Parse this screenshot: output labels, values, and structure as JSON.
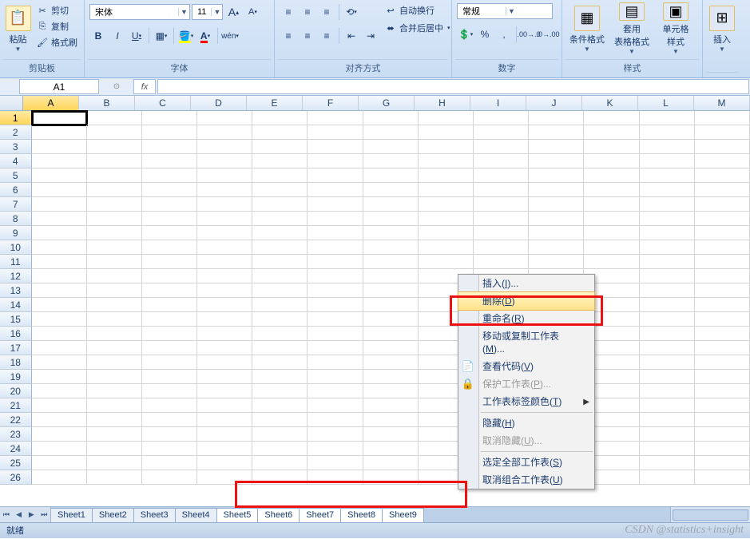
{
  "ribbon": {
    "clipboard": {
      "paste": "粘贴",
      "cut": "剪切",
      "copy": "复制",
      "format_painter": "格式刷",
      "group_label": "剪贴板"
    },
    "font": {
      "font_name": "宋体",
      "font_size": "11",
      "group_label": "字体"
    },
    "alignment": {
      "wrap_text": "自动换行",
      "merge_center": "合并后居中",
      "group_label": "对齐方式"
    },
    "number": {
      "format": "常规",
      "group_label": "数字"
    },
    "styles": {
      "conditional": "条件格式",
      "format_table": "套用\n表格格式",
      "cell_styles": "单元格\n样式",
      "group_label": "样式"
    },
    "cells": {
      "insert": "插入"
    }
  },
  "name_box": "A1",
  "fx_label": "fx",
  "columns": [
    "A",
    "B",
    "C",
    "D",
    "E",
    "F",
    "G",
    "H",
    "I",
    "J",
    "K",
    "L",
    "M"
  ],
  "rows": [
    "1",
    "2",
    "3",
    "4",
    "5",
    "6",
    "7",
    "8",
    "9",
    "10",
    "11",
    "12",
    "13",
    "14",
    "15",
    "16",
    "17",
    "18",
    "19",
    "20",
    "21",
    "22",
    "23",
    "24",
    "25",
    "26"
  ],
  "sheets": [
    "Sheet1",
    "Sheet2",
    "Sheet3",
    "Sheet4",
    "Sheet5",
    "Sheet6",
    "Sheet7",
    "Sheet8",
    "Sheet9"
  ],
  "context_menu": {
    "insert": "插入(I)...",
    "delete": "删除(D)",
    "rename": "重命名(R)",
    "move_copy": "移动或复制工作表(M)...",
    "view_code": "查看代码(V)",
    "protect": "保护工作表(P)...",
    "tab_color": "工作表标签颜色(T)",
    "hide": "隐藏(H)",
    "unhide": "取消隐藏(U)...",
    "select_all": "选定全部工作表(S)",
    "ungroup": "取消组合工作表(U)"
  },
  "status": "就绪",
  "watermark": "CSDN @statistics+insight"
}
